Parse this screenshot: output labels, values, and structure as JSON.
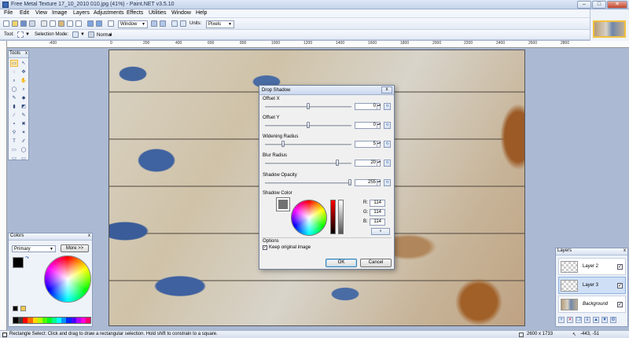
{
  "window": {
    "title": "Free Metal Texture 17_10_2010 010.jpg (41%) - Paint.NET v3.5.10",
    "min": "–",
    "max": "□",
    "close": "✕"
  },
  "menu": [
    "File",
    "Edit",
    "View",
    "Image",
    "Layers",
    "Adjustments",
    "Effects",
    "Utilities",
    "Window",
    "Help"
  ],
  "toolbar": {
    "zoom_value": "Window",
    "units_label": "Units:",
    "units_value": "Pixels"
  },
  "toolbar2": {
    "tool_label": "Tool:",
    "selection_mode_label": "Selection Mode:",
    "blend_value": "Normal"
  },
  "ruler": {
    "h_ticks": [
      "-400",
      "0",
      "200",
      "400",
      "600",
      "800",
      "1000",
      "1200",
      "1400",
      "1600",
      "1800",
      "2000",
      "2200",
      "2400",
      "2600",
      "2800"
    ]
  },
  "tools_panel": {
    "title": "Tools",
    "close": "x",
    "icons": [
      "▭",
      "↖",
      "◌",
      "✥",
      "⌕",
      "✋",
      "◯",
      "⌕",
      "✎",
      "◆",
      "▮",
      "◩",
      "∕",
      "✎",
      "⚬",
      "✖",
      "⚲",
      "✶",
      "T",
      "∕∕",
      "▭",
      "◯",
      "▭",
      "▭"
    ]
  },
  "colors_panel": {
    "title": "Colors",
    "close": "x",
    "mode": "Primary",
    "more_button": "More >>",
    "primary_color": "#000000",
    "secondary_color": "#ffffff",
    "palette": [
      "#000000",
      "#404040",
      "#ff0000",
      "#ff6a00",
      "#ffd800",
      "#b6ff00",
      "#4cff00",
      "#00ff21",
      "#00ff90",
      "#00ffff",
      "#0094ff",
      "#0026ff",
      "#4800ff",
      "#b200ff",
      "#ff00dc",
      "#ff006e"
    ]
  },
  "layers_panel": {
    "title": "Layers",
    "close": "x",
    "items": [
      {
        "name": "Layer 2",
        "visible": "✓",
        "italic": false
      },
      {
        "name": "Layer 3",
        "visible": "✓",
        "italic": false,
        "selected": true
      },
      {
        "name": "Background",
        "visible": "✓",
        "italic": true
      }
    ]
  },
  "dialog": {
    "title": "Drop Shadow",
    "close": "x",
    "sliders": [
      {
        "label": "Offset X",
        "value": "0",
        "fraction": 0.5
      },
      {
        "label": "Offset Y",
        "value": "0",
        "fraction": 0.5
      },
      {
        "label": "Widening Radius",
        "value": "5",
        "fraction": 0.2
      },
      {
        "label": "Blur Radius",
        "value": "20",
        "fraction": 0.85
      },
      {
        "label": "Shadow Opacity",
        "value": "255",
        "fraction": 1.0
      }
    ],
    "shadow_color_label": "Shadow Color",
    "shadow_color": "#727272",
    "r_label": "R:",
    "r_value": "114",
    "g_label": "G:",
    "g_value": "114",
    "b_label": "B:",
    "b_value": "114",
    "options_label": "Options",
    "keep_original": "Keep original image",
    "ok": "OK",
    "cancel": "Cancel"
  },
  "status": {
    "hint": "Rectangle Select: Click and drag to draw a rectangular selection. Hold shift to constrain to a square.",
    "size": "2600 x 1733",
    "coords": "-443, -51"
  }
}
